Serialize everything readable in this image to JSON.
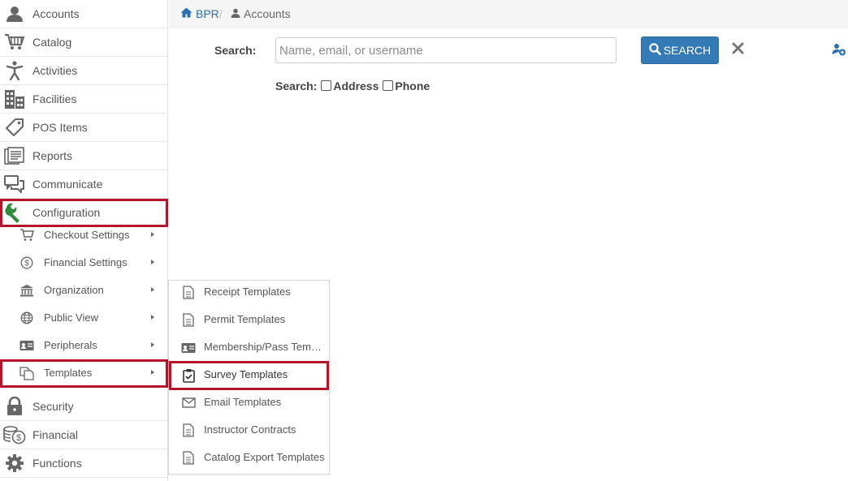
{
  "sidebar": {
    "items": [
      {
        "label": "Accounts",
        "icon": "user-icon"
      },
      {
        "label": "Catalog",
        "icon": "cart-icon"
      },
      {
        "label": "Activities",
        "icon": "person-activity-icon"
      },
      {
        "label": "Facilities",
        "icon": "building-icon"
      },
      {
        "label": "POS Items",
        "icon": "tag-icon"
      },
      {
        "label": "Reports",
        "icon": "reports-icon"
      },
      {
        "label": "Communicate",
        "icon": "chat-icon"
      },
      {
        "label": "Configuration",
        "icon": "wrench-icon"
      }
    ],
    "config_sub": [
      {
        "label": "Checkout Settings",
        "icon": "cart-icon"
      },
      {
        "label": "Financial Settings",
        "icon": "dollar-circle-icon"
      },
      {
        "label": "Organization",
        "icon": "bank-icon"
      },
      {
        "label": "Public View",
        "icon": "globe-icon"
      },
      {
        "label": "Peripherals",
        "icon": "id-card-icon"
      },
      {
        "label": "Templates",
        "icon": "copy-icon"
      }
    ],
    "bottom_items": [
      {
        "label": "Security",
        "icon": "lock-icon"
      },
      {
        "label": "Financial",
        "icon": "coins-icon"
      },
      {
        "label": "Functions",
        "icon": "gear-icon"
      }
    ]
  },
  "templates_menu": [
    {
      "label": "Receipt Templates",
      "icon": "document-icon"
    },
    {
      "label": "Permit Templates",
      "icon": "document-icon"
    },
    {
      "label": "Membership/Pass Templ...",
      "icon": "id-card-icon"
    },
    {
      "label": "Survey Templates",
      "icon": "clipboard-check-icon"
    },
    {
      "label": "Email Templates",
      "icon": "envelope-icon"
    },
    {
      "label": "Instructor Contracts",
      "icon": "document-icon"
    },
    {
      "label": "Catalog Export Templates",
      "icon": "document-icon"
    }
  ],
  "breadcrumb": {
    "home": "BPR",
    "separator": "/",
    "current": "Accounts"
  },
  "search": {
    "label": "Search:",
    "placeholder": "Name, email, or username",
    "value": "",
    "button": "SEARCH",
    "options_label": "Search:",
    "option_address": "Address",
    "option_phone": "Phone"
  },
  "colors": {
    "accent": "#337ab7",
    "highlight": "#b5142b",
    "link": "#2a6fb0",
    "config_icon": "#2e8b3a"
  }
}
